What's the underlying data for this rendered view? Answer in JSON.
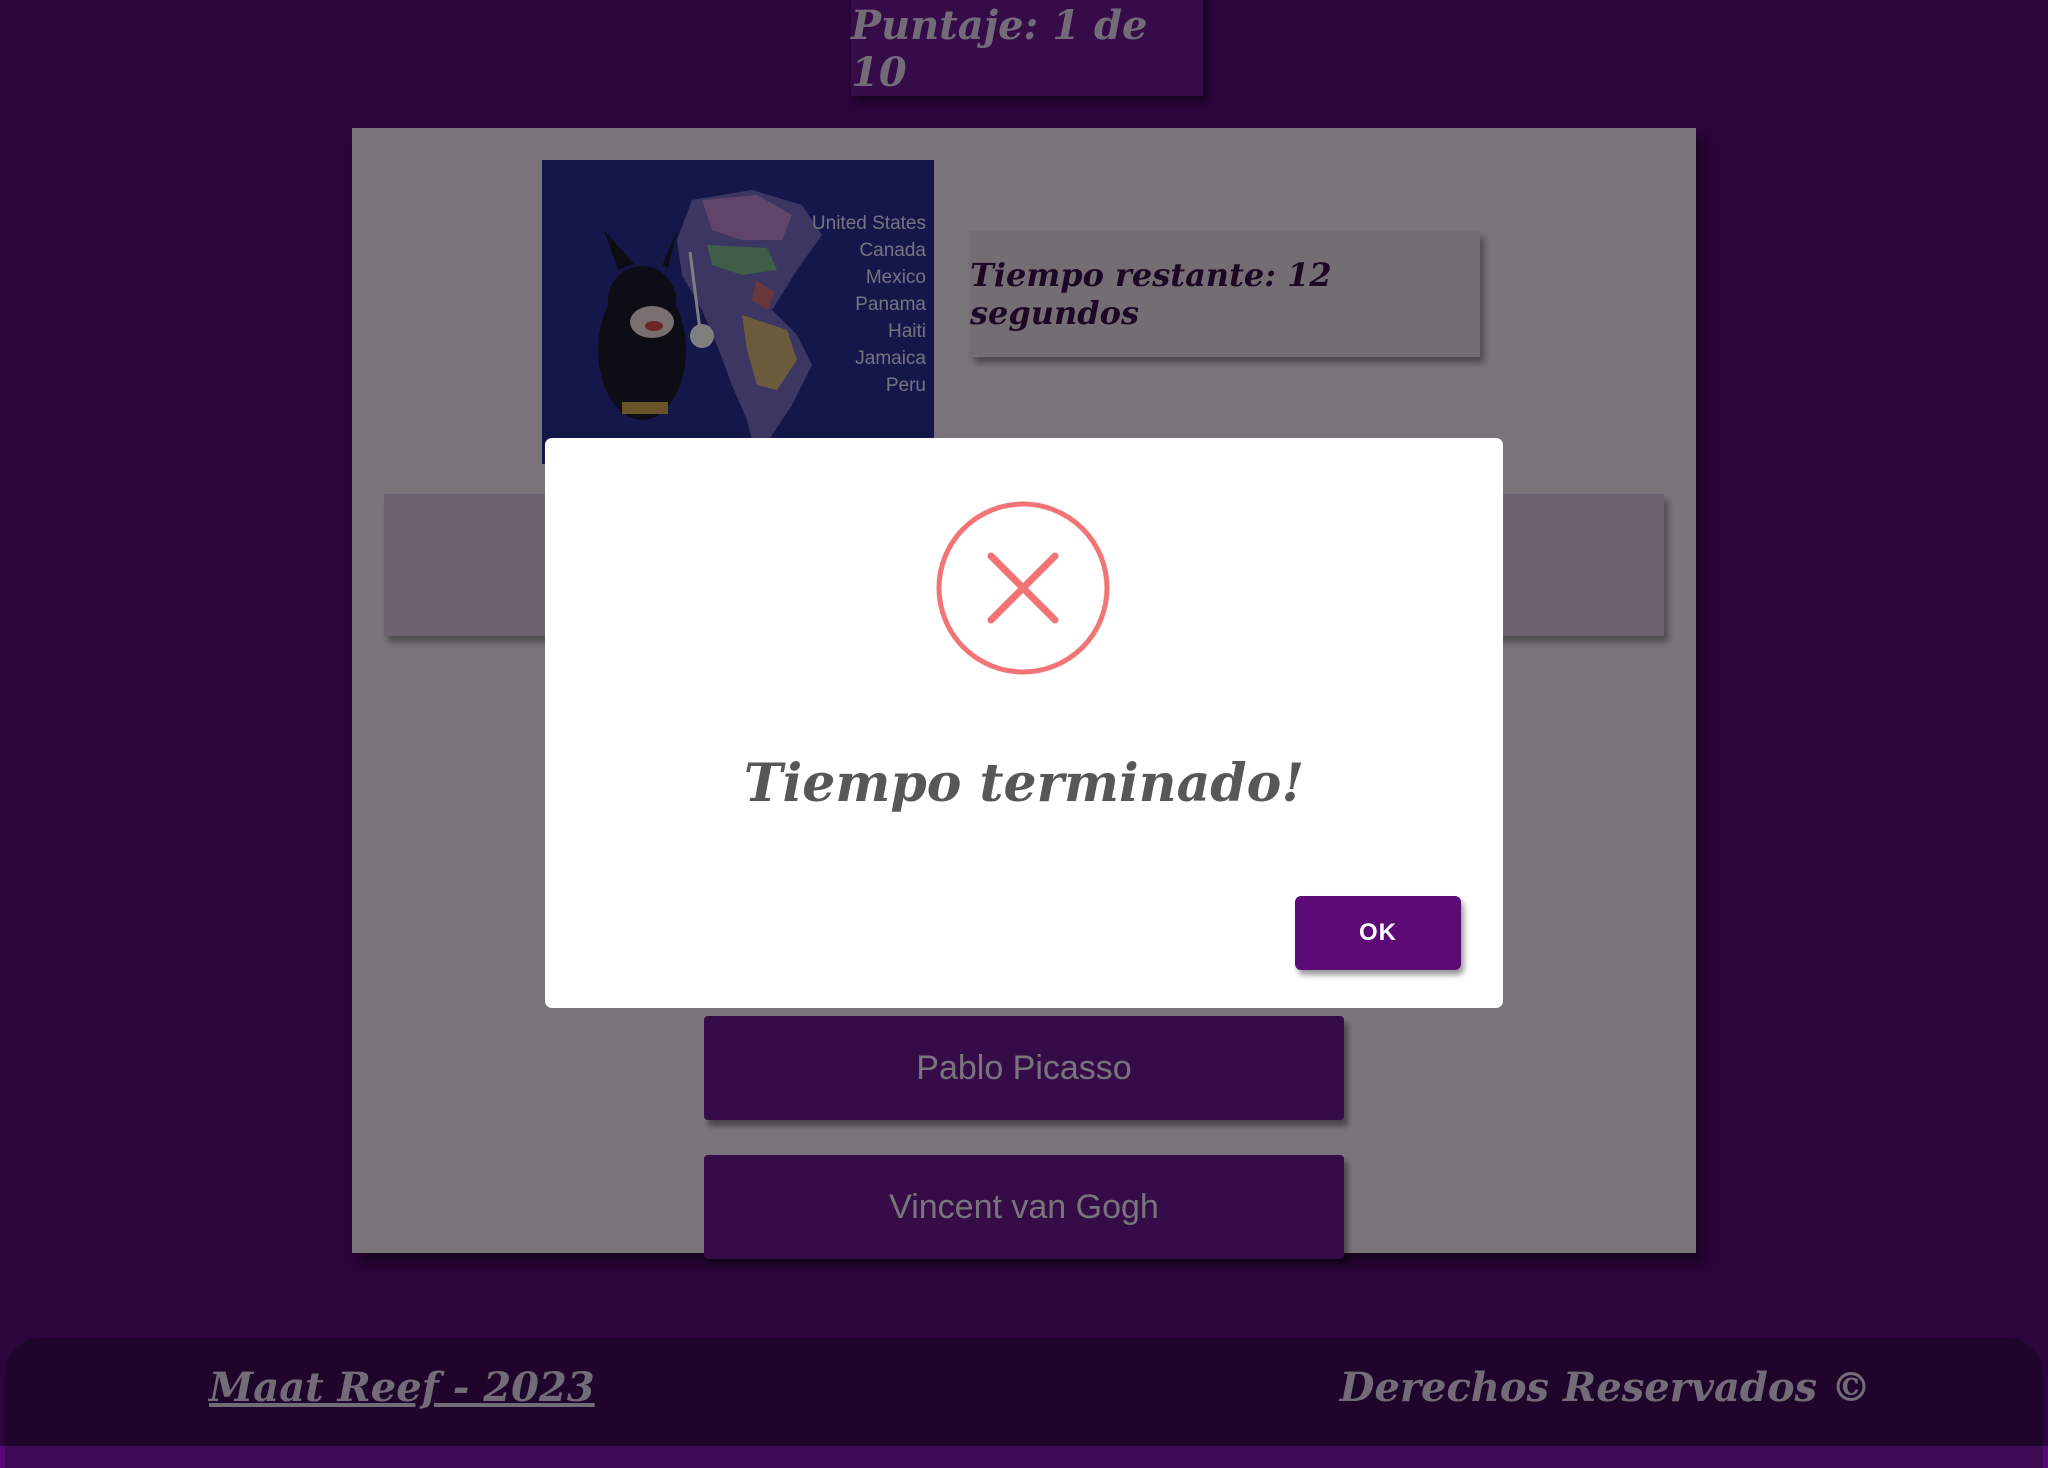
{
  "header": {
    "score_label": "Puntaje: 1 de 10"
  },
  "quiz": {
    "image": {
      "map_labels": [
        "United States",
        "Canada",
        "Mexico",
        "Panama",
        "Haiti",
        "Jamaica",
        "Peru"
      ]
    },
    "timer_label": "Tiempo restante: 12 segundos",
    "answers": [
      {
        "label": "Pablo Picasso"
      },
      {
        "label": "Vincent van Gogh"
      }
    ]
  },
  "modal": {
    "icon": "error-x-icon",
    "title": "Tiempo terminado!",
    "ok_label": "OK"
  },
  "footer": {
    "left_link": "Maat Reef - 2023",
    "right_text": "Derechos Reservados ©"
  },
  "colors": {
    "background": "#570a77",
    "accent": "#5b0a76",
    "error": "#f27474"
  }
}
